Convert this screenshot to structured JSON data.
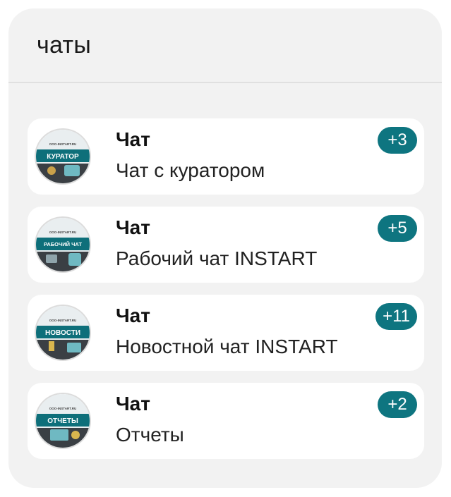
{
  "header": {
    "title": "чаты"
  },
  "chats": [
    {
      "avatar_label": "КУРАТОР",
      "avatar_site": "OOO-INSTART.RU",
      "name": "Чат",
      "preview": "Чат с куратором",
      "badge": "+3"
    },
    {
      "avatar_label": "РАБОЧИЙ ЧАТ",
      "avatar_site": "OOO-INSTART.RU",
      "name": "Чат",
      "preview": "Рабочий чат INSTART",
      "badge": "+5"
    },
    {
      "avatar_label": "НОВОСТИ",
      "avatar_site": "OOO-INSTART.RU",
      "name": "Чат",
      "preview": "Новостной чат INSTART",
      "badge": "+11"
    },
    {
      "avatar_label": "ОТЧЕТЫ",
      "avatar_site": "OOO-INSTART.RU",
      "name": "Чат",
      "preview": "Отчеты",
      "badge": "+2"
    }
  ],
  "colors": {
    "badge": "#0e7580",
    "avatar_band": "#0e6f7a"
  }
}
